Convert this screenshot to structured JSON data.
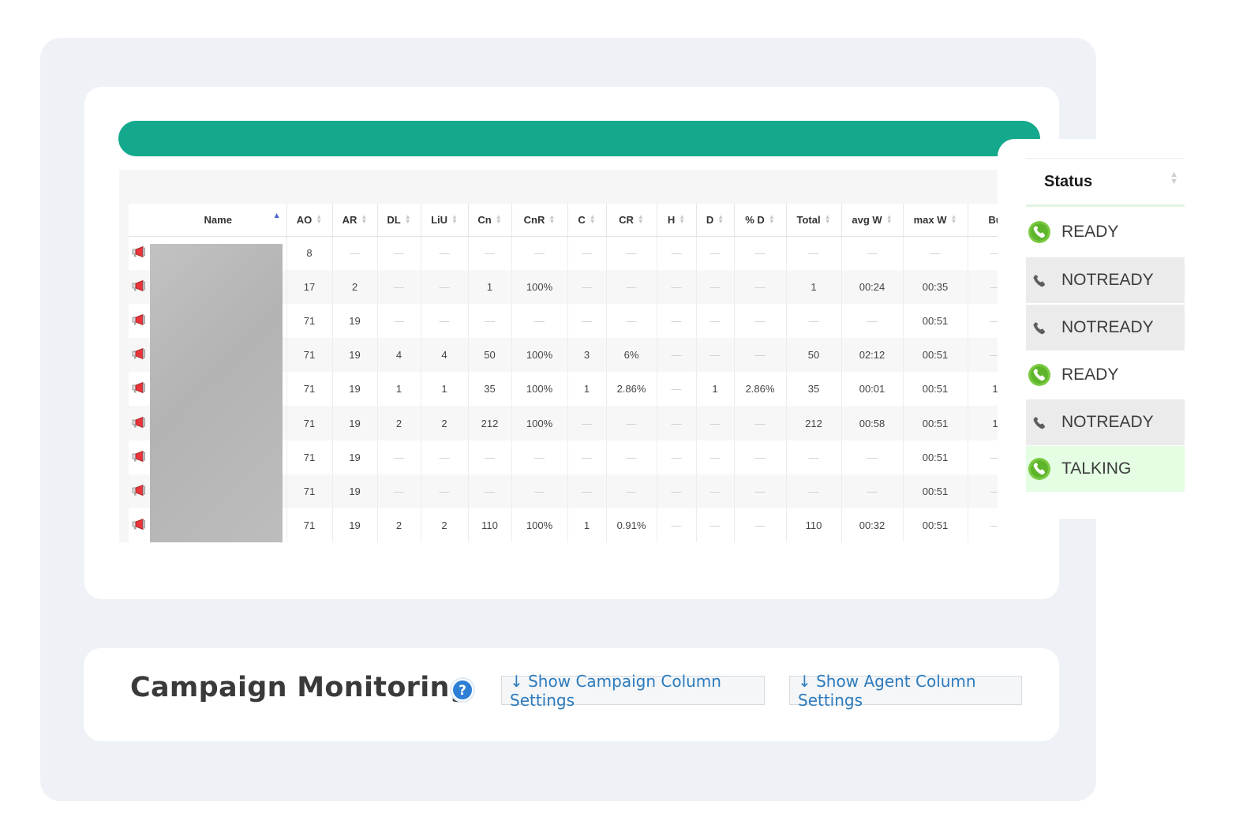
{
  "table": {
    "columns": [
      "Name",
      "AO",
      "AR",
      "DL",
      "LiU",
      "Cn",
      "CnR",
      "C",
      "CR",
      "H",
      "D",
      "% D",
      "Total",
      "avg W",
      "max W",
      "Bu"
    ],
    "rows": [
      [
        "",
        "8",
        "—",
        "—",
        "—",
        "—",
        "—",
        "—",
        "—",
        "—",
        "—",
        "—",
        "—",
        "—",
        "—",
        "—"
      ],
      [
        "",
        "17",
        "2",
        "—",
        "—",
        "1",
        "100%",
        "—",
        "—",
        "—",
        "—",
        "—",
        "1",
        "00:24",
        "00:35",
        "—"
      ],
      [
        "",
        "71",
        "19",
        "—",
        "—",
        "—",
        "—",
        "—",
        "—",
        "—",
        "—",
        "—",
        "—",
        "—",
        "00:51",
        "—"
      ],
      [
        "",
        "71",
        "19",
        "4",
        "4",
        "50",
        "100%",
        "3",
        "6%",
        "—",
        "—",
        "—",
        "50",
        "02:12",
        "00:51",
        "—"
      ],
      [
        "",
        "71",
        "19",
        "1",
        "1",
        "35",
        "100%",
        "1",
        "2.86%",
        "—",
        "1",
        "2.86%",
        "35",
        "00:01",
        "00:51",
        "1"
      ],
      [
        "",
        "71",
        "19",
        "2",
        "2",
        "212",
        "100%",
        "—",
        "—",
        "—",
        "—",
        "—",
        "212",
        "00:58",
        "00:51",
        "1"
      ],
      [
        "",
        "71",
        "19",
        "—",
        "—",
        "—",
        "—",
        "—",
        "—",
        "—",
        "—",
        "—",
        "—",
        "—",
        "00:51",
        "—"
      ],
      [
        "",
        "71",
        "19",
        "—",
        "—",
        "—",
        "—",
        "—",
        "—",
        "—",
        "—",
        "—",
        "—",
        "—",
        "00:51",
        "—"
      ],
      [
        "",
        "71",
        "19",
        "2",
        "2",
        "110",
        "100%",
        "1",
        "0.91%",
        "—",
        "—",
        "—",
        "110",
        "00:32",
        "00:51",
        "—"
      ]
    ]
  },
  "status_panel": {
    "header": "Status",
    "items": [
      {
        "label": "READY",
        "state": "ready",
        "icon": "phone-ready-icon"
      },
      {
        "label": "NOTREADY",
        "state": "notready",
        "icon": "phone-notready-icon"
      },
      {
        "label": "NOTREADY",
        "state": "notready",
        "icon": "phone-notready-icon"
      },
      {
        "label": "READY",
        "state": "ready",
        "icon": "phone-ready-icon"
      },
      {
        "label": "NOTREADY",
        "state": "notready",
        "icon": "phone-notready-icon"
      },
      {
        "label": "TALKING",
        "state": "talking",
        "icon": "phone-ready-icon"
      }
    ]
  },
  "monitor": {
    "title": "Campaign Monitoring",
    "help_icon": "help-icon",
    "campaign_settings_label": "↓ Show Campaign Column Settings",
    "agent_settings_label": "↓ Show Agent Column Settings"
  },
  "colors": {
    "accent": "#14a98c",
    "ready_icon": "#7ac943",
    "notready_icon": "#6b6b6b",
    "talking_bg": "#e4fde3",
    "link": "#2c7bbd"
  }
}
